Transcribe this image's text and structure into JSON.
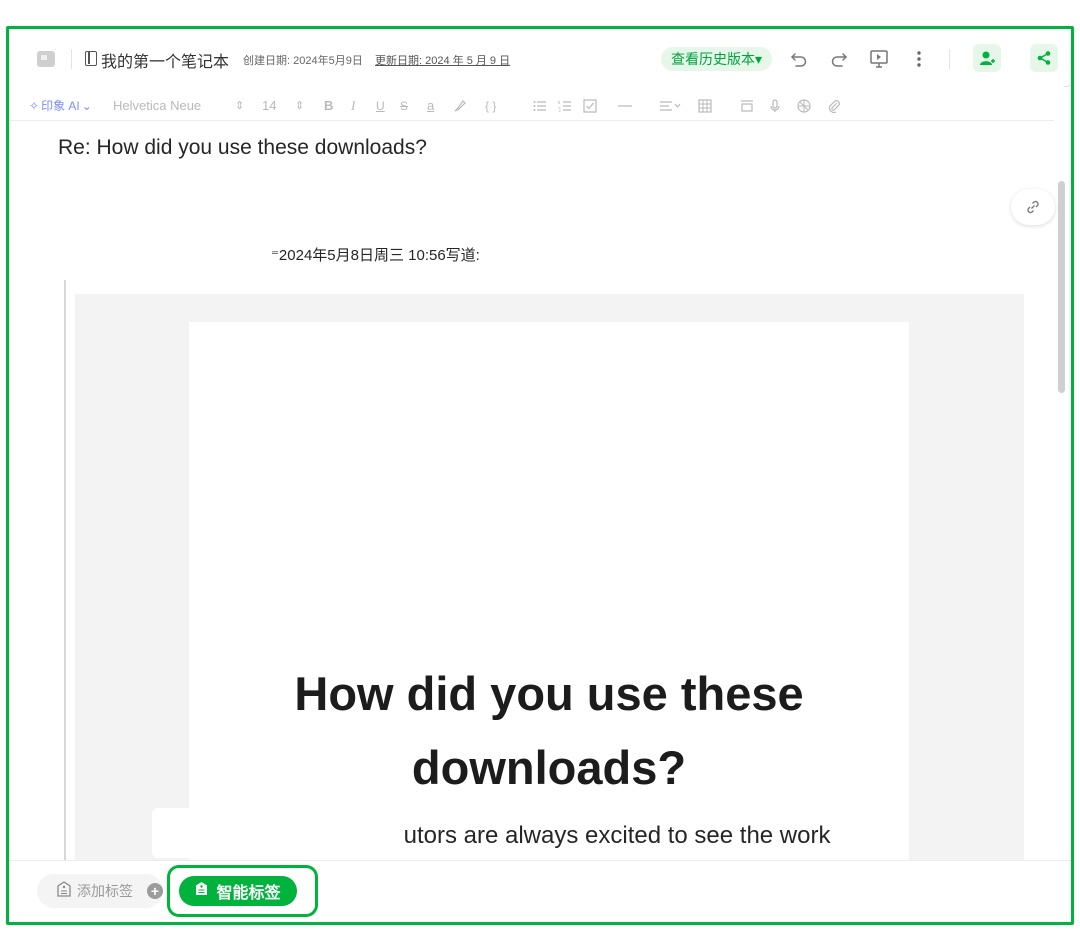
{
  "header": {
    "notebook_name": "我的第一个笔记本",
    "created": "创建日期: 2024年5月9日",
    "updated": "更新日期: 2024 年 5 月 9 日",
    "history_button": "查看历史版本▾"
  },
  "toolbar": {
    "ai_label": "印象 AI",
    "font_family": "Helvetica Neue",
    "font_size": "14",
    "bold": "B",
    "italic": "I",
    "underline": "U",
    "strike": "S",
    "font_color": "a",
    "code": "{ }"
  },
  "note": {
    "title": "Re: How did you use these downloads?",
    "wrote_line": "⁼2024年5月8日周三 10:56写道:",
    "email_heading": "How did you use these downloads?",
    "email_body": "  utors are always excited to see the work"
  },
  "tagbar": {
    "add_tag": "添加标签",
    "smart_tag": "智能标签"
  },
  "colors": {
    "brand_green": "#00b33c",
    "light_green": "#e6f7ea"
  }
}
